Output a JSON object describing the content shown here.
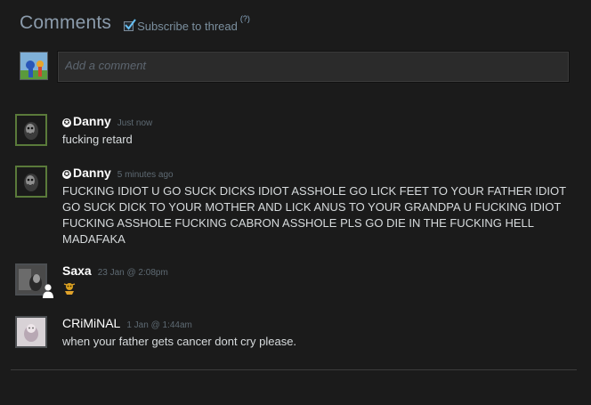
{
  "header": {
    "title": "Comments",
    "subscribe_label": "Subscribe to thread",
    "subscribe_checked": true,
    "help": "(?)"
  },
  "compose": {
    "placeholder": "Add a comment"
  },
  "comments": [
    {
      "author": "Danny",
      "badge_icon": "star-badge-icon",
      "timestamp": "Just now",
      "text": "fucking retard"
    },
    {
      "author": "Danny",
      "badge_icon": "star-badge-icon",
      "timestamp": "5 minutes ago",
      "text": "FUCKING IDIOT U GO SUCK DICKS IDIOT ASSHOLE GO LICK FEET TO YOUR FATHER IDIOT GO SUCK DICK TO YOUR MOTHER AND LICK ANUS TO YOUR GRANDPA U FUCKING IDIOT FUCKING ASSHOLE FUCKING CABRON ASSHOLE PLS GO DIE IN THE FUCKING HELL MADAFAKA"
    },
    {
      "author": "Saxa",
      "timestamp": "23 Jan @ 2:08pm",
      "text": "",
      "emoticon": "emoticon-icon"
    },
    {
      "author": "CRiMiNAL",
      "timestamp": "1 Jan @ 1:44am",
      "text": "when your father gets cancer dont cry please."
    }
  ],
  "colors": {
    "background": "#1b1b1b",
    "title": "#8b9bab",
    "author": "#ffffff",
    "timestamp": "#5e6a73",
    "online_border": "#5a7a3a",
    "offline_border": "#4c4f52"
  }
}
